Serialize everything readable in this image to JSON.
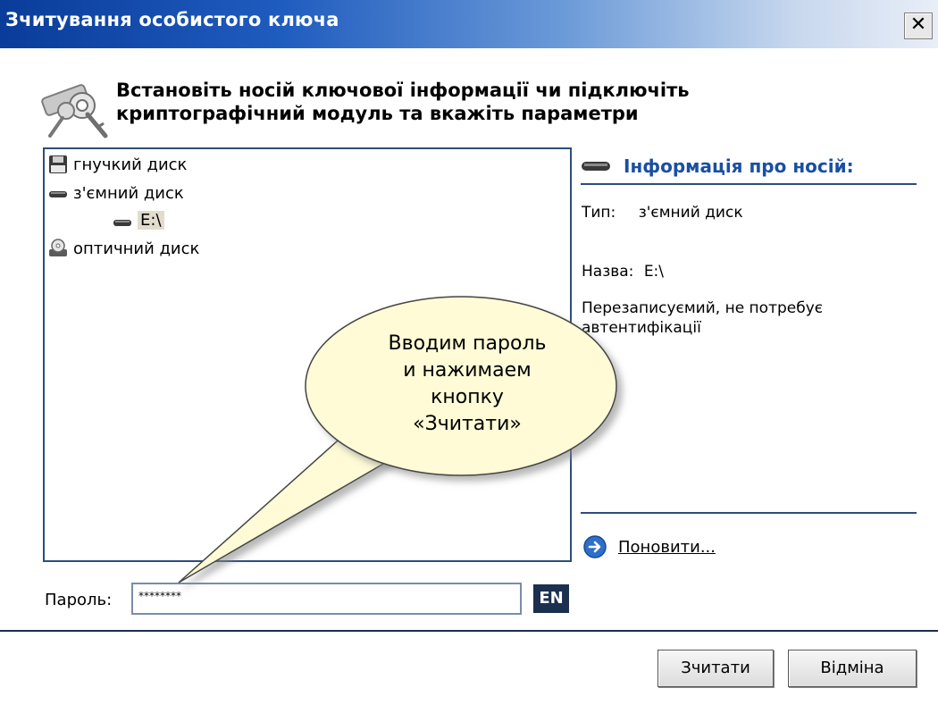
{
  "window": {
    "title": "Зчитування особистого ключа",
    "close_symbol": "✕"
  },
  "header": {
    "icon": "keys-icon",
    "line1": "Встановіть носій ключової інформації чи підключіть",
    "line2": "криптографічний модуль та вкажіть параметри"
  },
  "tree": {
    "items": [
      {
        "label": "гнучкий диск",
        "icon": "floppy-disk-icon"
      },
      {
        "label": "з'ємний диск",
        "icon": "removable-drive-icon"
      },
      {
        "label": "E:\\",
        "icon": "removable-drive-icon",
        "selected": true
      },
      {
        "label": "оптичний диск",
        "icon": "optical-drive-icon"
      }
    ]
  },
  "info": {
    "title": "Інформація про носій:",
    "type_label": "Тип:",
    "type_value": "з'ємний диск",
    "name_label": "Назва:",
    "name_value": "E:\\",
    "description_line1": "Перезаписуємий, не потребує",
    "description_line2": "автентифікації",
    "refresh_label": "Поновити..."
  },
  "password": {
    "label": "Пароль:",
    "value": "********",
    "language": "EN"
  },
  "buttons": {
    "read": "Зчитати",
    "cancel": "Відміна"
  },
  "callout": {
    "line1": "Вводим пароль",
    "line2": "и нажимаем",
    "line3": "кнопку",
    "line4": "«Зчитати»"
  },
  "colors": {
    "title_bar_start": "#0a3c9a",
    "info_title": "#1a4fa3",
    "callout_fill": "#fefbd6",
    "lang_badge": "#1b2f4f"
  }
}
